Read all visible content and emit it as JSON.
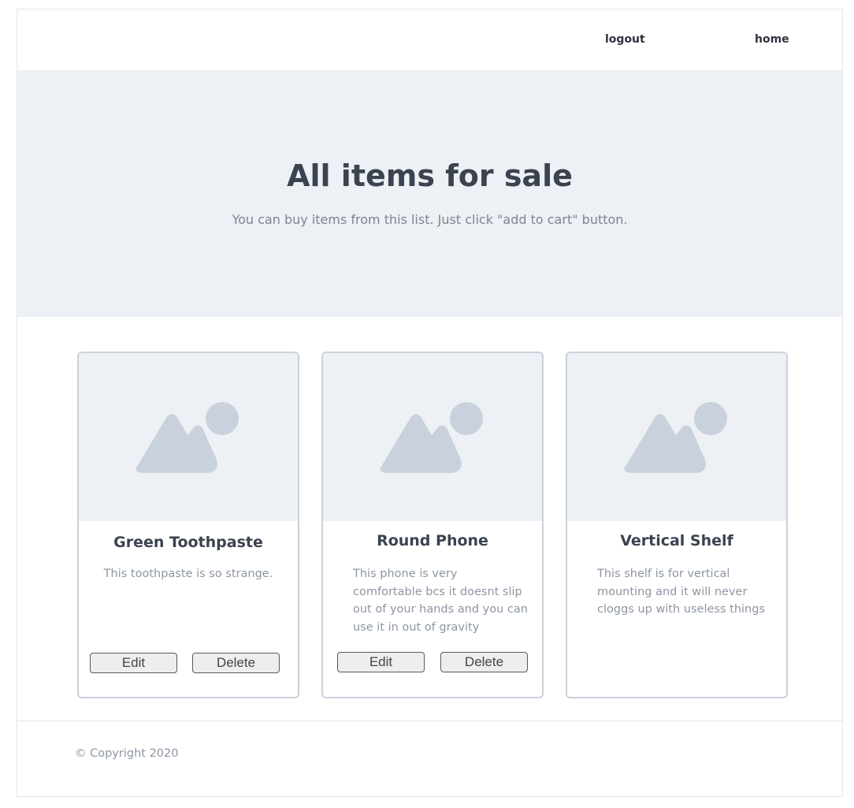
{
  "nav": {
    "logout_label": "logout",
    "home_label": "home"
  },
  "hero": {
    "title": "All items for sale",
    "subtitle": "You can buy items from this list. Just click \"add to cart\" button."
  },
  "items": [
    {
      "name": "Green Toothpaste",
      "description": "This toothpaste is so strange.",
      "image_icon": "image-placeholder-icon",
      "edit_label": "Edit",
      "delete_label": "Delete"
    },
    {
      "name": "Round Phone",
      "description": "This phone is very comfortable bcs it doesnt slip out of your hands and you can use it in out of gravity",
      "image_icon": "image-placeholder-icon",
      "edit_label": "Edit",
      "delete_label": "Delete"
    },
    {
      "name": "Vertical Shelf",
      "description": "This shelf is for vertical mounting and it will never cloggs up with useless things",
      "image_icon": "image-placeholder-icon"
    }
  ],
  "footer": {
    "copyright": "© Copyright 2020"
  },
  "colors": {
    "hero_bg": "#edf0f4",
    "title_text": "#3b4250",
    "muted_text": "#8d96a3",
    "card_border": "#c9d2dc",
    "placeholder_shape": "#c9d2dc"
  }
}
